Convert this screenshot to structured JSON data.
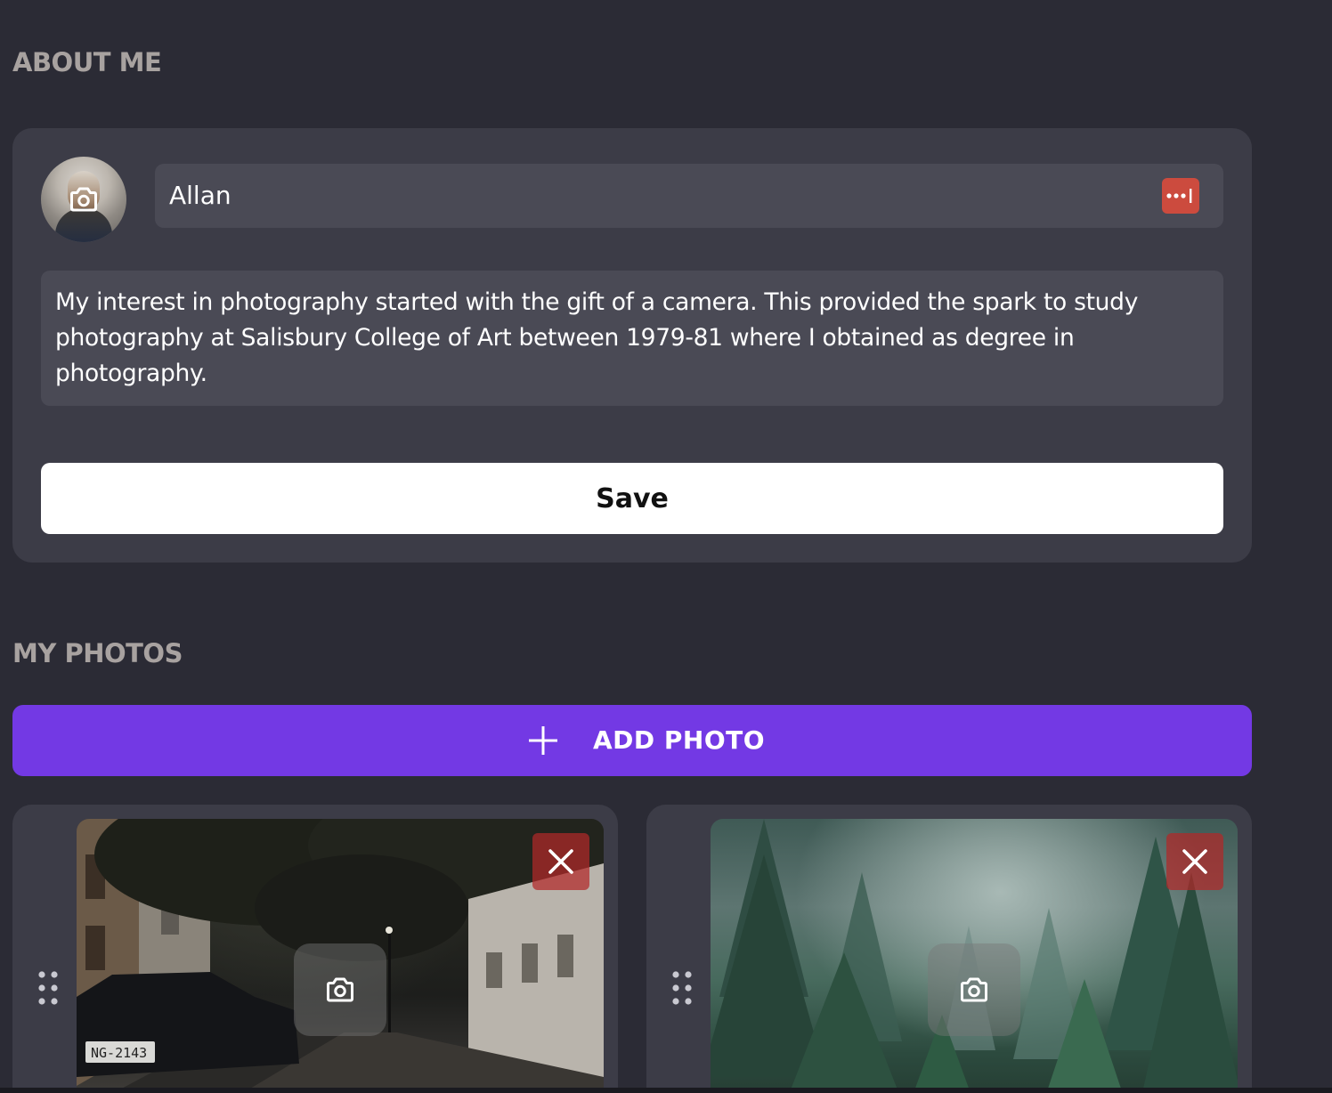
{
  "about": {
    "title": "ABOUT ME",
    "name_value": "Allan",
    "bio_value": "My interest in photography started with the gift of a camera. This provided the spark to study photography at Salisbury College of Art between 1979-81 where I obtained as degree in photography.",
    "save_label": "Save",
    "avatar_icon": "camera-icon",
    "password_badge_icon": "password-manager-icon"
  },
  "photos": {
    "title": "MY PHOTOS",
    "add_label": "ADD PHOTO",
    "add_icon": "plus-icon",
    "items": [
      {
        "subject": "rainy city street",
        "plate_text": "NG-2143",
        "delete_icon": "close-icon",
        "change_icon": "camera-icon",
        "drag_icon": "drag-handle-icon"
      },
      {
        "subject": "misty pine forest",
        "delete_icon": "close-icon",
        "change_icon": "camera-icon",
        "drag_icon": "drag-handle-icon"
      }
    ]
  },
  "colors": {
    "background": "#2b2b35",
    "card": "#3c3c47",
    "field": "#4a4a55",
    "heading": "#a8a2a0",
    "accent": "#7339e4",
    "delete": "#b22828",
    "password_badge": "#cc4b3e"
  }
}
